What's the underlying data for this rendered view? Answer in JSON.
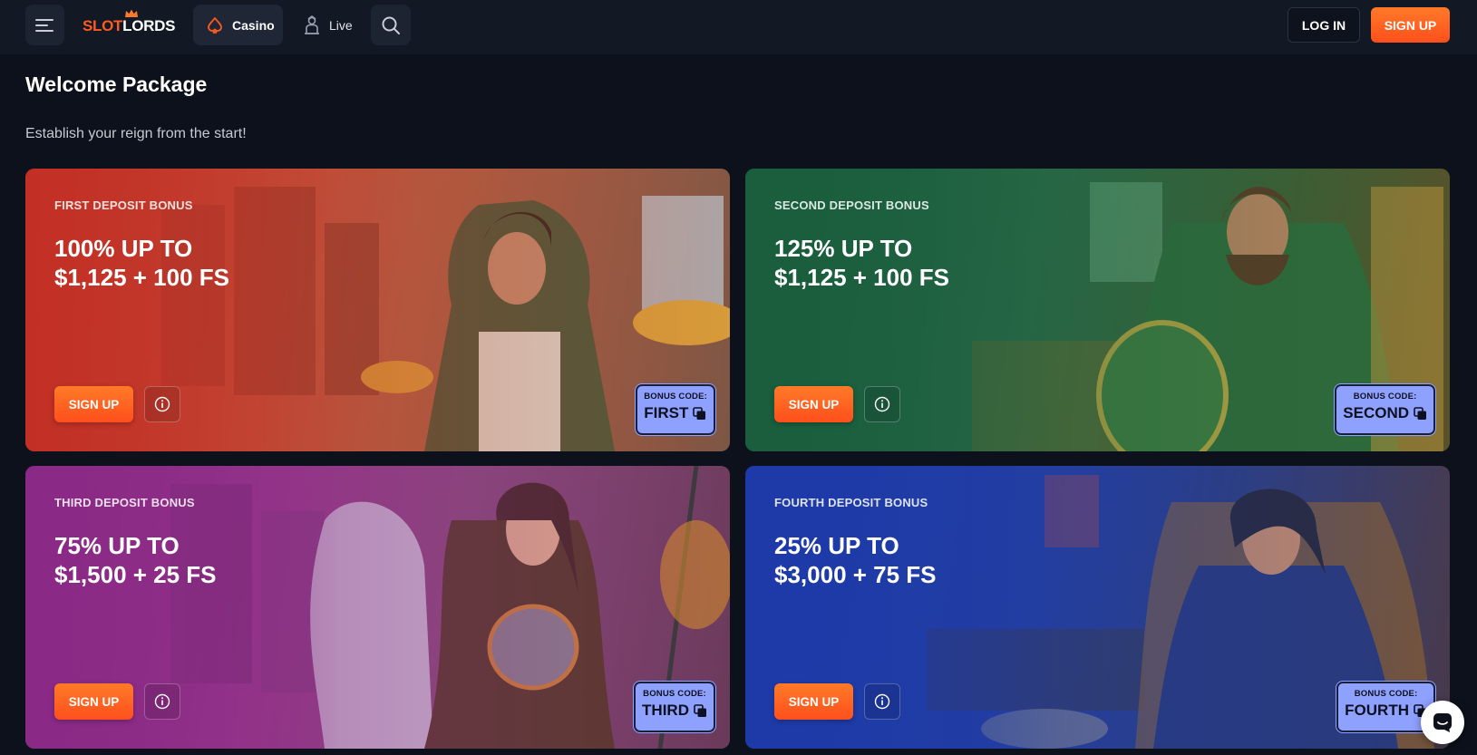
{
  "header": {
    "logo_left": "SLOT",
    "logo_right": "LORDS",
    "nav": [
      {
        "label": "Casino",
        "icon": "spade-icon"
      },
      {
        "label": "Live",
        "icon": "dealer-icon"
      }
    ],
    "login_label": "LOG IN",
    "signup_label": "SIGN UP"
  },
  "main": {
    "title": "Welcome Package",
    "subtitle": "Establish your reign from the start!",
    "cards": [
      {
        "kicker": "FIRST DEPOSIT BONUS",
        "offer": "100% UP TO\n$1,125 + 100 FS",
        "signup_label": "SIGN UP",
        "code_caption": "BONUS CODE:",
        "code": "FIRST",
        "theme": "#c93a2a"
      },
      {
        "kicker": "SECOND DEPOSIT BONUS",
        "offer": "125% UP TO\n$1,125 + 100 FS",
        "signup_label": "SIGN UP",
        "code_caption": "BONUS CODE:",
        "code": "SECOND",
        "theme": "#1e6b45"
      },
      {
        "kicker": "THIRD DEPOSIT BONUS",
        "offer": "75% UP TO\n$1,500 + 25 FS",
        "signup_label": "SIGN UP",
        "code_caption": "BONUS CODE:",
        "code": "THIRD",
        "theme": "#8a2d86"
      },
      {
        "kicker": "FOURTH DEPOSIT BONUS",
        "offer": "25% UP TO\n$3,000 + 75 FS",
        "signup_label": "SIGN UP",
        "code_caption": "BONUS CODE:",
        "code": "FOURTH",
        "theme": "#1d3a9c"
      }
    ]
  },
  "colors": {
    "accent": "#ff5a1f",
    "code_box": "#8fa1ff",
    "background": "#0c111b"
  }
}
